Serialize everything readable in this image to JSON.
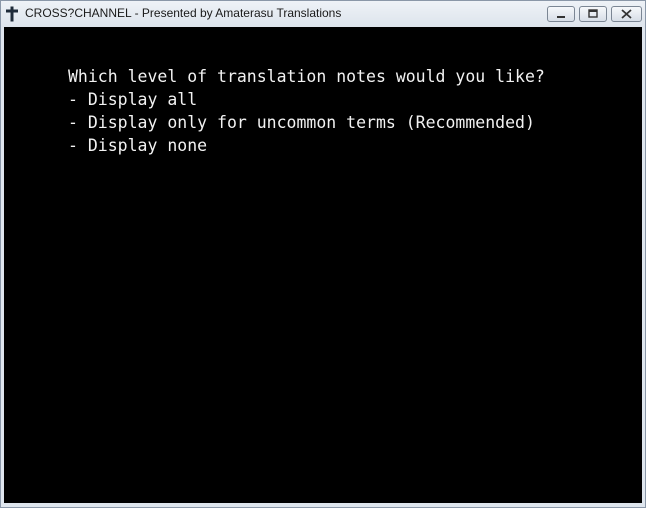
{
  "window": {
    "title": "CROSS?CHANNEL - Presented by Amaterasu Translations",
    "app_icon": "cross-icon",
    "controls": [
      "minimize-icon",
      "maximize-icon",
      "close-icon"
    ]
  },
  "menu": {
    "prompt": "Which level of translation notes would you like?",
    "options": [
      "- Display all",
      "- Display only for uncommon terms (Recommended)",
      "- Display none"
    ]
  },
  "colors": {
    "screen_background": "#000000",
    "text": "#f2f2f2"
  }
}
